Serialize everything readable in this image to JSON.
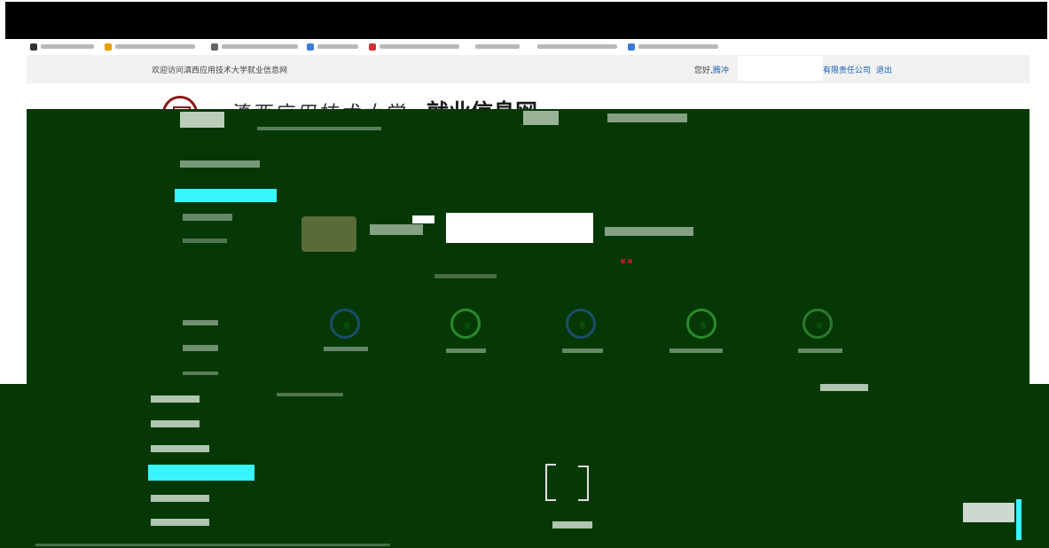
{
  "topbar": {
    "welcome": "欢迎访问滇西应用技术大学就业信息网",
    "greeting": "您好,",
    "user_link": "腾冲",
    "company_suffix": "有限责任公司",
    "logout": "退出"
  },
  "header": {
    "university_name": "滇西应用技术大学",
    "site_name": "就业信息网"
  },
  "colors": {
    "green_overlay": "#063806",
    "highlight_cyan": "#38f5ff",
    "link_blue": "#1a5fb4",
    "logo_red": "#8b1a1a"
  },
  "icons": [
    "logo-seal-icon",
    "user-avatar-icon",
    "stat-circle-icon"
  ]
}
